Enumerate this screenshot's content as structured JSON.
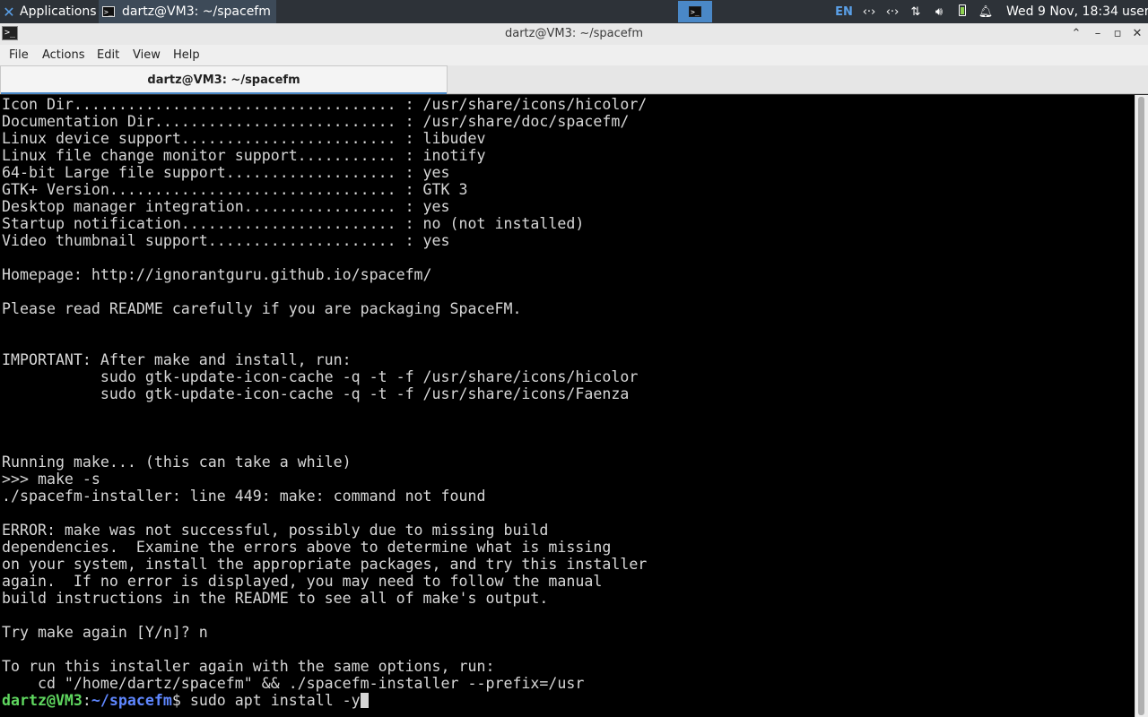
{
  "panel": {
    "applications_label": "Applications",
    "task_title": "dartz@VM3: ~/spacefm",
    "keyboard_layout": "EN",
    "clock": "Wed  9 Nov, 18:34",
    "user": "user"
  },
  "window": {
    "title": "dartz@VM3: ~/spacefm"
  },
  "menu": {
    "file": "File",
    "actions": "Actions",
    "edit": "Edit",
    "view": "View",
    "help": "Help"
  },
  "tab": {
    "label": "dartz@VM3: ~/spacefm"
  },
  "terminal": {
    "lines": [
      "Icon Dir.................................... : /usr/share/icons/hicolor/",
      "Documentation Dir........................... : /usr/share/doc/spacefm/",
      "Linux device support........................ : libudev",
      "Linux file change monitor support........... : inotify",
      "64-bit Large file support................... : yes",
      "GTK+ Version................................ : GTK 3",
      "Desktop manager integration................. : yes",
      "Startup notification........................ : no (not installed)",
      "Video thumbnail support..................... : yes",
      "",
      "Homepage: http://ignorantguru.github.io/spacefm/",
      "",
      "Please read README carefully if you are packaging SpaceFM.",
      "",
      "",
      "IMPORTANT: After make and install, run:",
      "           sudo gtk-update-icon-cache -q -t -f /usr/share/icons/hicolor",
      "           sudo gtk-update-icon-cache -q -t -f /usr/share/icons/Faenza",
      "",
      "",
      "",
      "Running make... (this can take a while)",
      ">>> make -s",
      "./spacefm-installer: line 449: make: command not found",
      "",
      "ERROR: make was not successful, possibly due to missing build",
      "dependencies.  Examine the errors above to determine what is missing",
      "on your system, install the appropriate packages, and try this installer",
      "again.  If no error is displayed, you may need to follow the manual",
      "build instructions in the README to see all of make's output.",
      "",
      "Try make again [Y/n]? n",
      "",
      "To run this installer again with the same options, run:",
      "    cd \"/home/dartz/spacefm\" && ./spacefm-installer --prefix=/usr"
    ],
    "prompt": {
      "user_host": "dartz@VM3",
      "separator": ":",
      "path": "~/spacefm",
      "symbol": "$",
      "command": " sudo apt install -y"
    }
  }
}
